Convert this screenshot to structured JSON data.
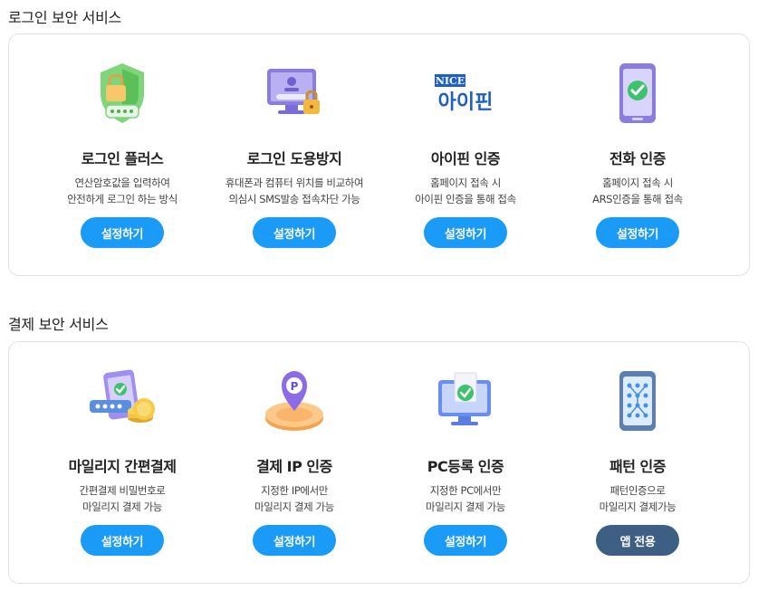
{
  "login_section": {
    "title": "로그인 보안 서비스",
    "cards": [
      {
        "icon": "shield-lock-icon",
        "title": "로그인 플러스",
        "desc": [
          "연산암호값을 입력하여",
          "안전하게 로그인 하는 방식"
        ],
        "button": "설정하기"
      },
      {
        "icon": "monitor-lock-icon",
        "title": "로그인 도용방지",
        "desc": [
          "휴대폰과 컴퓨터 위치를 비교하여",
          "의심시 SMS발송 접속차단 가능"
        ],
        "button": "설정하기"
      },
      {
        "icon": "nice-ipin-logo",
        "logo_top": "NICE",
        "logo_main": "아이핀",
        "title": "아이핀 인증",
        "desc": [
          "홈페이지 접속 시",
          "아이핀 인증을 통해 접속"
        ],
        "button": "설정하기"
      },
      {
        "icon": "phone-check-icon",
        "title": "전화 인증",
        "desc": [
          "홈페이지 접속 시",
          "ARS인증을 통해 접속"
        ],
        "button": "설정하기"
      }
    ]
  },
  "payment_section": {
    "title": "결제 보안 서비스",
    "cards": [
      {
        "icon": "mileage-payment-icon",
        "title": "마일리지 간편결제",
        "desc": [
          "간편결제 비밀번호로",
          "마일리지 결제 가능"
        ],
        "button": "설정하기"
      },
      {
        "icon": "location-pin-icon",
        "title": "결제 IP 인증",
        "desc": [
          "지정한 IP에서만",
          "마일리지 결제 가능"
        ],
        "button": "설정하기"
      },
      {
        "icon": "pc-check-icon",
        "title": "PC등록 인증",
        "desc": [
          "지정한 PC에서만",
          "마일리지 결제 가능"
        ],
        "button": "설정하기"
      },
      {
        "icon": "pattern-phone-icon",
        "title": "패턴 인증",
        "desc": [
          "패턴인증으로",
          "마일리지 결제가능"
        ],
        "button": "앱 전용"
      }
    ]
  },
  "colors": {
    "primary_button": "#1a9bf7",
    "app_only_button": "#3d5f84",
    "nice_logo": "#1f5fbf"
  }
}
